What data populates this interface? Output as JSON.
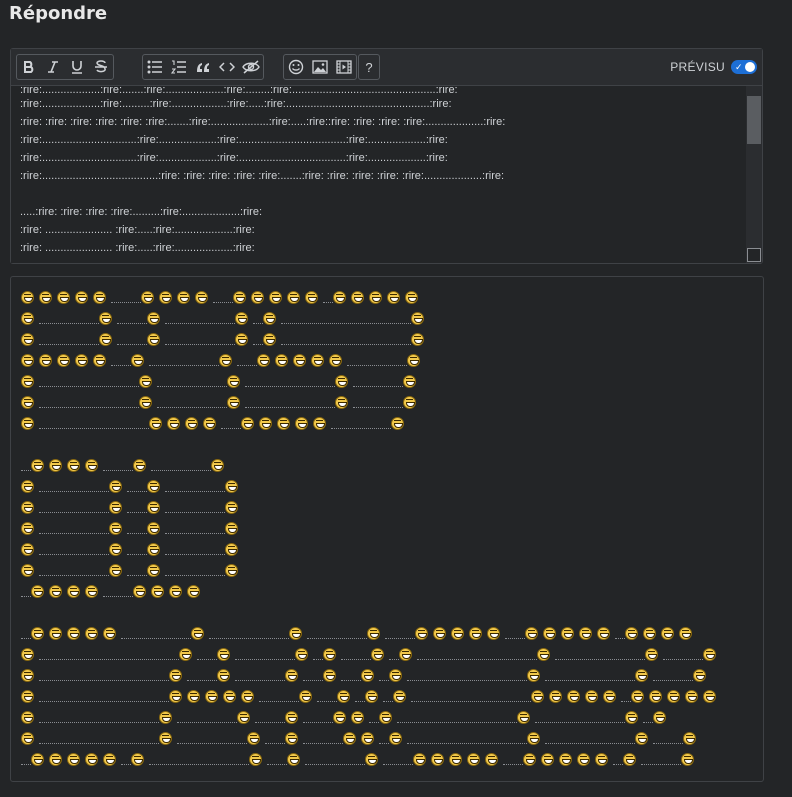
{
  "page": {
    "title": "Répondre"
  },
  "toolbar": {
    "buttons": [
      "bold-icon",
      "italic-icon",
      "underline-icon",
      "strikethrough-icon",
      "bullet-list-icon",
      "numbered-list-icon",
      "quote-icon",
      "code-icon",
      "hide-icon",
      "emoji-icon",
      "image-icon",
      "video-icon",
      "help-icon"
    ],
    "preview_label": "PRÉVISU",
    "preview_on": true
  },
  "editor": {
    "lines": [
      ":rire:...................:rire:.......:rire:...................:rire:........:rire:...............................................:rire:",
      ":rire:...................:rire:.........:rire:..................:rire:.....:rire:...............................................:rire:",
      ":rire: :rire: :rire: :rire: :rire: :rire:.......:rire:...................:rire:.....:rire::rire: :rire: :rire: :rire:...................:rire:",
      ":rire:...............................:rire:...................:rire:...................................:rire:...................:rire:",
      ":rire:...............................:rire:...................:rire:...................................:rire:...................:rire:",
      ":rire:......................................:rire: :rire: :rire: :rire: :rire:.......:rire: :rire: :rire: :rire: :rire:...................:rire:",
      "",
      ".....:rire: :rire: :rire: :rire:.........:rire:...................:rire:",
      ":rire: ...................... :rire:.....:rire:...................:rire:",
      ":rire: ...................... :rire:.....:rire:...................:rire:"
    ]
  },
  "preview": {
    "emoji_name": "rire-emoji"
  }
}
